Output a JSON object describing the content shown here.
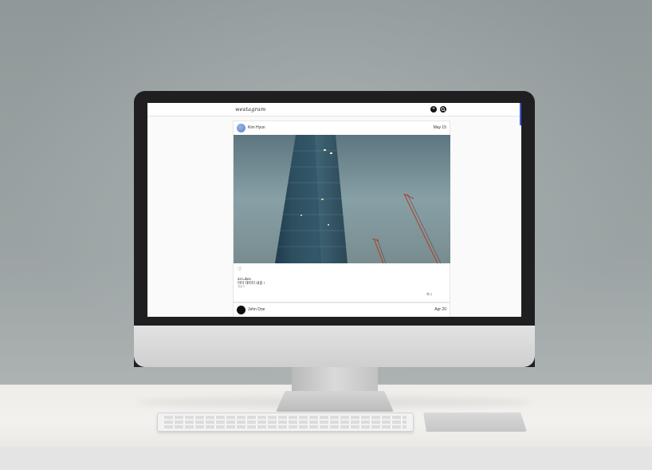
{
  "app": {
    "logo_text": "westagram"
  },
  "header": {
    "icons": [
      "plus-circle-icon",
      "search-icon"
    ]
  },
  "feed": {
    "posts": [
      {
        "username": "Kim Hyun",
        "date": "May 15",
        "likes_text": "34 Likes",
        "caption": "마이 데이터 내용 !",
        "meta_text": "댓글 0",
        "more_label": "게시",
        "image_alt": "skyscraper-photo"
      },
      {
        "username": "John Doe",
        "date": "Apr 20"
      }
    ]
  },
  "colors": {
    "accent": "#3b5bdb",
    "bezel": "#1f1f21",
    "wall": "#a0a7a8"
  }
}
